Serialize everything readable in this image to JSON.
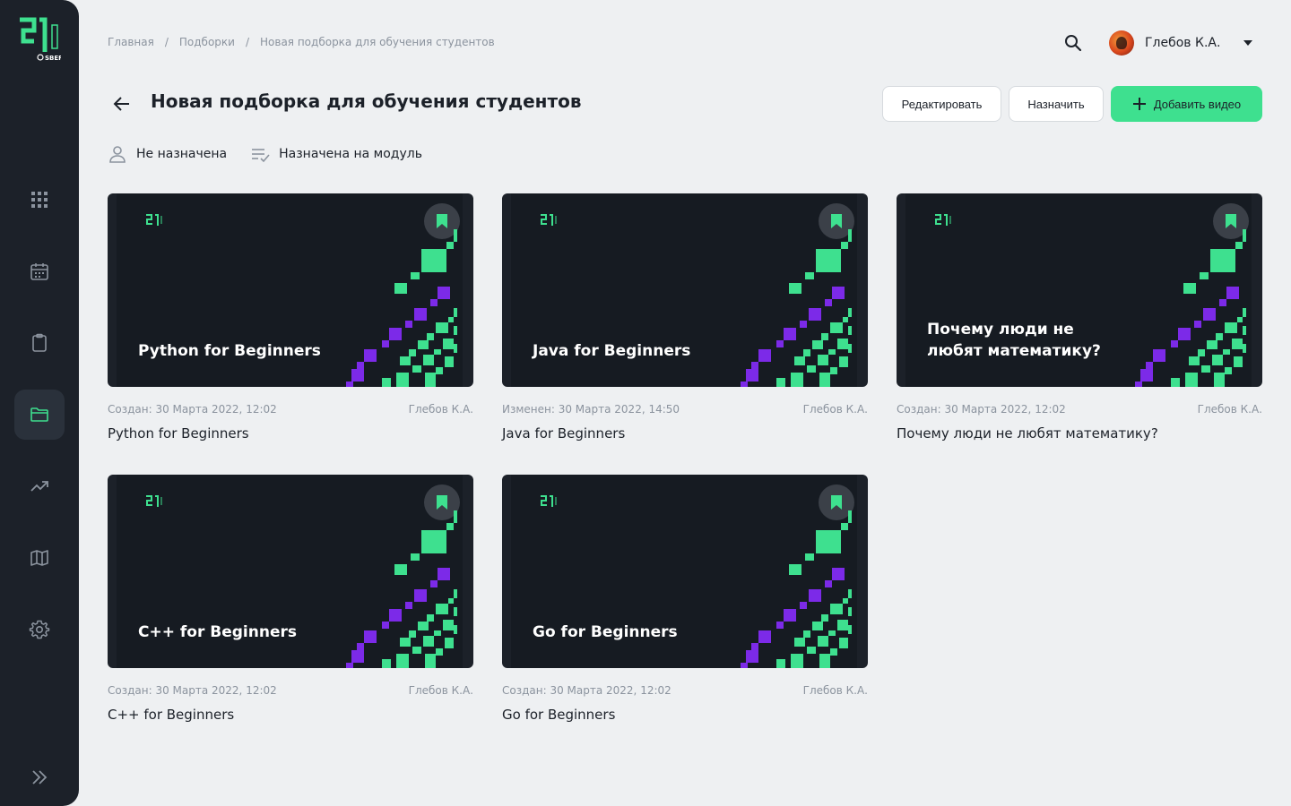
{
  "brand": {
    "logo_text": "21",
    "sub_text": "SBER"
  },
  "sidebar": {
    "items": [
      {
        "name": "grid",
        "icon": "grid-icon"
      },
      {
        "name": "calendar",
        "icon": "calendar-icon"
      },
      {
        "name": "clipboard",
        "icon": "clipboard-icon"
      },
      {
        "name": "folder",
        "icon": "folder-icon",
        "active": true
      },
      {
        "name": "trend",
        "icon": "trending-up-icon"
      },
      {
        "name": "map",
        "icon": "map-icon"
      },
      {
        "name": "settings",
        "icon": "gear-icon"
      }
    ],
    "expand_icon": "chevrons-right-icon"
  },
  "breadcrumb": [
    "Главная",
    "Подборки",
    "Новая подборка для обучения студентов"
  ],
  "user": {
    "name": "Глебов К.А."
  },
  "page": {
    "title": "Новая подборка для обучения студентов",
    "status_unassigned": "Не назначена",
    "status_module": "Назначена на модуль"
  },
  "actions": {
    "edit": "Редактировать",
    "assign": "Назначить",
    "add_video": "Добавить видео"
  },
  "colors": {
    "accent": "#3ee08f",
    "purple": "#7c2ae8",
    "dark": "#1c2129"
  },
  "cards": [
    {
      "thumb_title": "Python for Beginners",
      "meta": "Создан: 30 Марта 2022, 12:02",
      "author": "Глебов К.А.",
      "title": "Python for Beginners"
    },
    {
      "thumb_title": "Java for Beginners",
      "meta": "Изменен: 30 Марта 2022, 14:50",
      "author": "Глебов К.А.",
      "title": "Java for Beginners"
    },
    {
      "thumb_title": "Почему люди не любят математику?",
      "meta": "Создан: 30 Марта 2022, 12:02",
      "author": "Глебов К.А.",
      "title": "Почему люди не любят математику?"
    },
    {
      "thumb_title": "C++ for Beginners",
      "meta": "Создан: 30 Марта 2022, 12:02",
      "author": "Глебов К.А.",
      "title": "C++ for Beginners"
    },
    {
      "thumb_title": "Go for Beginners",
      "meta": "Создан: 30 Марта 2022, 12:02",
      "author": "Глебов К.А.",
      "title": "Go for Beginners"
    }
  ]
}
